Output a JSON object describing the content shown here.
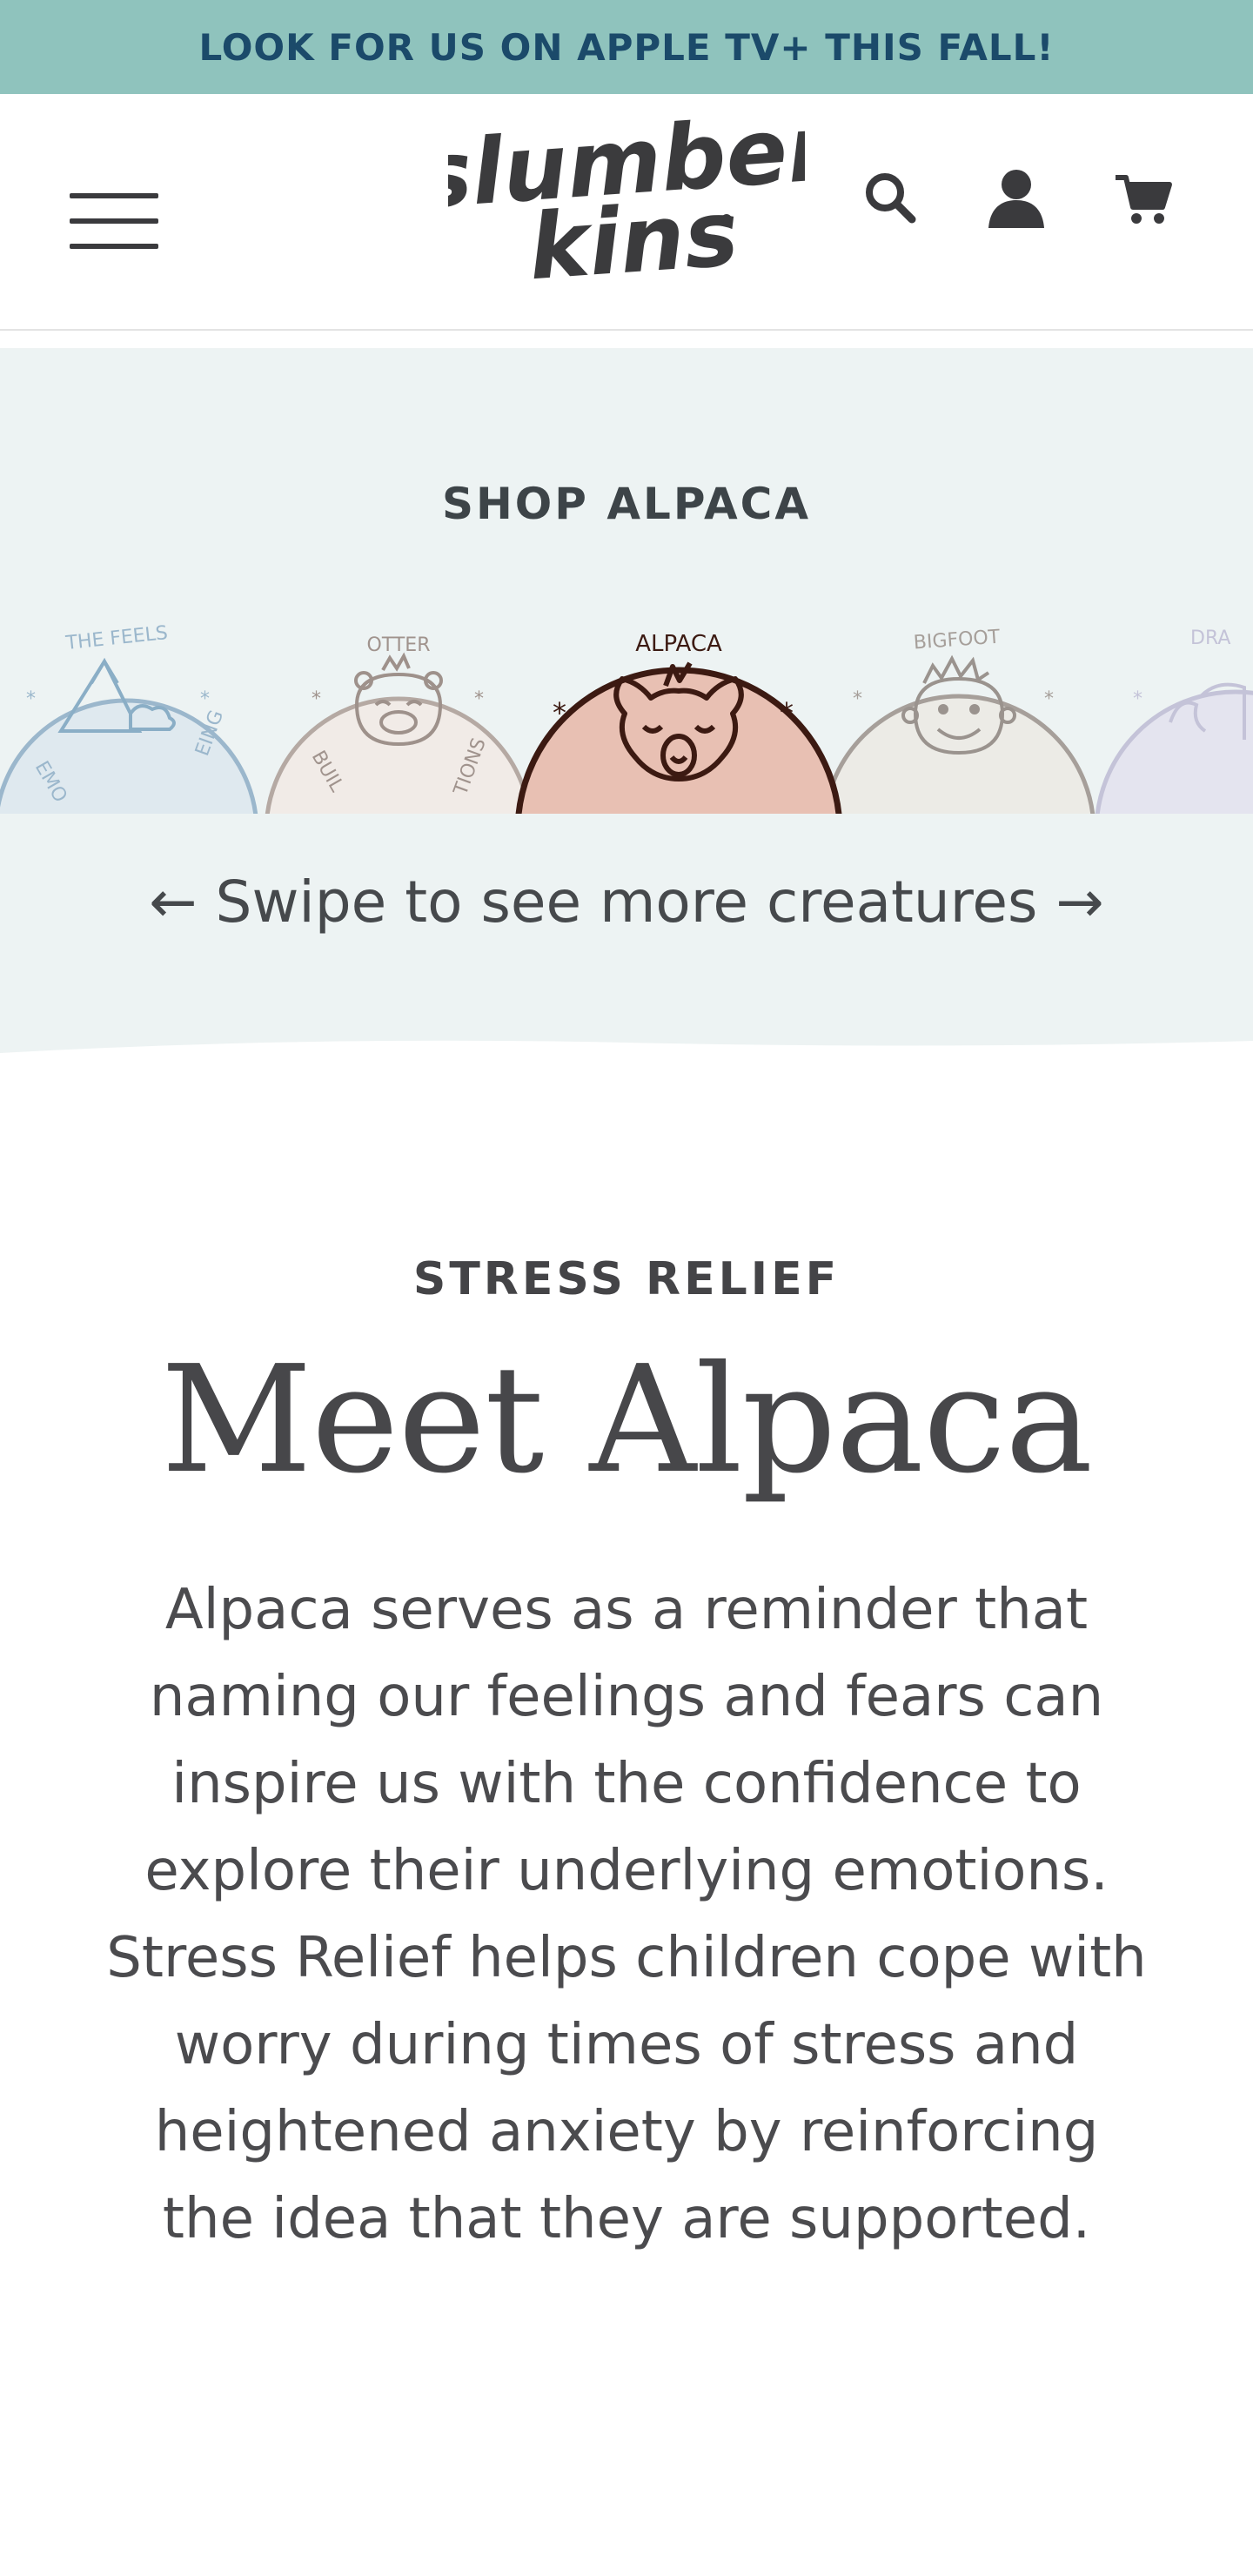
{
  "announcement": {
    "text": "LOOK FOR US ON APPLE TV+ THIS FALL!"
  },
  "header": {
    "logo_line1": "slumber",
    "logo_line2": "kins",
    "icons": [
      "hamburger-menu-icon",
      "search-icon",
      "account-icon",
      "cart-icon"
    ]
  },
  "shop": {
    "title": "SHOP ALPACA",
    "creatures": [
      {
        "label": "THE FEELS",
        "sublabel_left": "EMO",
        "sublabel_right": "EING",
        "icon": "mountain-icon",
        "color": "#dfe9ef",
        "border": "#9bb7cc"
      },
      {
        "label": "OTTER",
        "sublabel_left": "BUIL",
        "sublabel_right": "TIONS",
        "icon": "otter-face-icon",
        "color": "#f1ebe7",
        "border": "#b5a9a3"
      },
      {
        "label": "ALPACA",
        "icon": "alpaca-face-icon",
        "color": "#e8c0b3",
        "border": "#3c1a12",
        "selected": true
      },
      {
        "label": "BIGFOOT",
        "icon": "bigfoot-face-icon",
        "color": "#ecebe6",
        "border": "#a69f9a"
      },
      {
        "label": "DRA",
        "icon": "dragon-face-icon",
        "color": "#e4e4ef",
        "border": "#c4c3d8"
      }
    ],
    "swipe_hint": "← Swipe to see more creatures →"
  },
  "intro": {
    "eyebrow": "STRESS RELIEF",
    "headline": "Meet Alpaca",
    "body": "Alpaca serves as a reminder that naming our feelings and fears can inspire us with the confidence to explore their underlying emotions. Stress Relief helps children cope with worry during times of stress and heightened anxiety by reinforcing the idea that they are supported."
  },
  "colors": {
    "announcement_bg": "#8fc3bd",
    "announcement_text": "#1b4a6a",
    "shop_bg": "#edf3f3",
    "text": "#4a4a4d"
  }
}
